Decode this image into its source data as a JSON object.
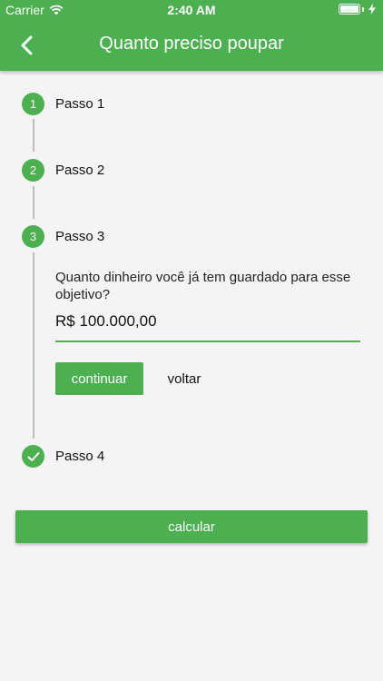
{
  "status_bar": {
    "carrier": "Carrier",
    "time": "2:40 AM"
  },
  "app_bar": {
    "title": "Quanto preciso poupar"
  },
  "steps": [
    {
      "number": "1",
      "label": "Passo 1",
      "state": "done"
    },
    {
      "number": "2",
      "label": "Passo 2",
      "state": "done"
    },
    {
      "number": "3",
      "label": "Passo 3",
      "state": "active"
    },
    {
      "number": "",
      "label": "Passo 4",
      "state": "complete"
    }
  ],
  "step3": {
    "question": "Quanto dinheiro você já tem guardado para esse objetivo?",
    "input_value": "R$ 100.000,00",
    "continue_label": "continuar",
    "back_label": "voltar"
  },
  "calculate_label": "calcular",
  "colors": {
    "accent": "#4caf50",
    "background": "#f4f4f4"
  }
}
